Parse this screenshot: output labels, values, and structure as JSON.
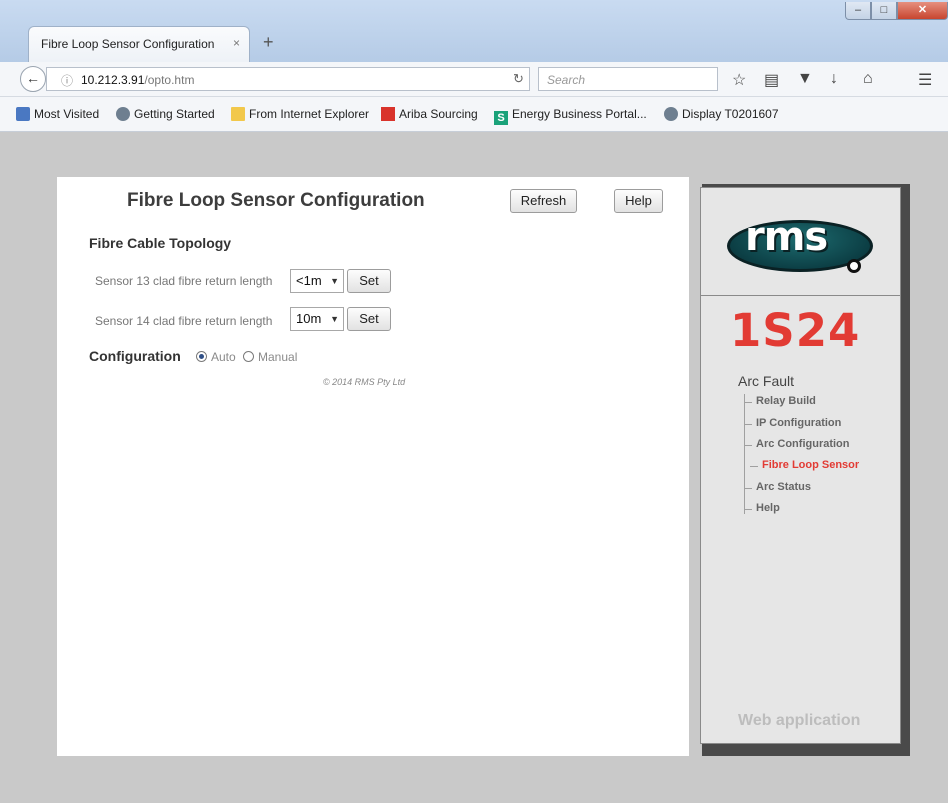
{
  "browser": {
    "tab_title": "Fibre Loop Sensor Configuration",
    "tab_close": "×",
    "new_tab": "+",
    "window_buttons": {
      "minimize": "–",
      "maximize": "□",
      "close": "✕"
    },
    "url_host": "10.212.3.91",
    "url_path": "/opto.htm",
    "search_placeholder": "Search",
    "bookmarks": [
      {
        "label": "Most Visited",
        "icon": "bookmark-icon",
        "color": "#4a78c2"
      },
      {
        "label": "Getting Started",
        "icon": "globe-icon",
        "color": "#6e7f90"
      },
      {
        "label": "From Internet Explorer",
        "icon": "folder-icon",
        "color": "#f2c84b"
      },
      {
        "label": "Ariba Sourcing",
        "icon": "ariba-icon",
        "color": "#d9332b"
      },
      {
        "label": "Energy Business Portal...",
        "icon": "s-logo-icon",
        "color": "#1aa27a"
      },
      {
        "label": "Display T0201607",
        "icon": "globe-icon",
        "color": "#6e7f90"
      }
    ]
  },
  "main": {
    "title": "Fibre Loop Sensor Configuration",
    "refresh_label": "Refresh",
    "help_label": "Help",
    "topology_heading": "Fibre Cable Topology",
    "sensors": [
      {
        "label": "Sensor 13 clad fibre return length",
        "value": "<1m",
        "set_label": "Set"
      },
      {
        "label": "Sensor 14 clad fibre return length",
        "value": "10m",
        "set_label": "Set"
      }
    ],
    "configuration_label": "Configuration",
    "config_options": [
      {
        "label": "Auto",
        "selected": true
      },
      {
        "label": "Manual",
        "selected": false
      }
    ],
    "copyright": "© 2014 RMS Pty Ltd"
  },
  "sidebar": {
    "logo_text": "rms",
    "model": "1S24",
    "nav_title": "Arc Fault",
    "nav_items": [
      {
        "label": "Relay Build",
        "active": false
      },
      {
        "label": "IP Configuration",
        "active": false
      },
      {
        "label": "Arc Configuration",
        "active": false
      },
      {
        "label": "Fibre Loop Sensor",
        "active": true
      },
      {
        "label": "Arc Status",
        "active": false
      },
      {
        "label": "Help",
        "active": false
      }
    ],
    "footer": "Web application"
  },
  "colors": {
    "accent": "#e23b34",
    "logo": "#0c3f45"
  }
}
